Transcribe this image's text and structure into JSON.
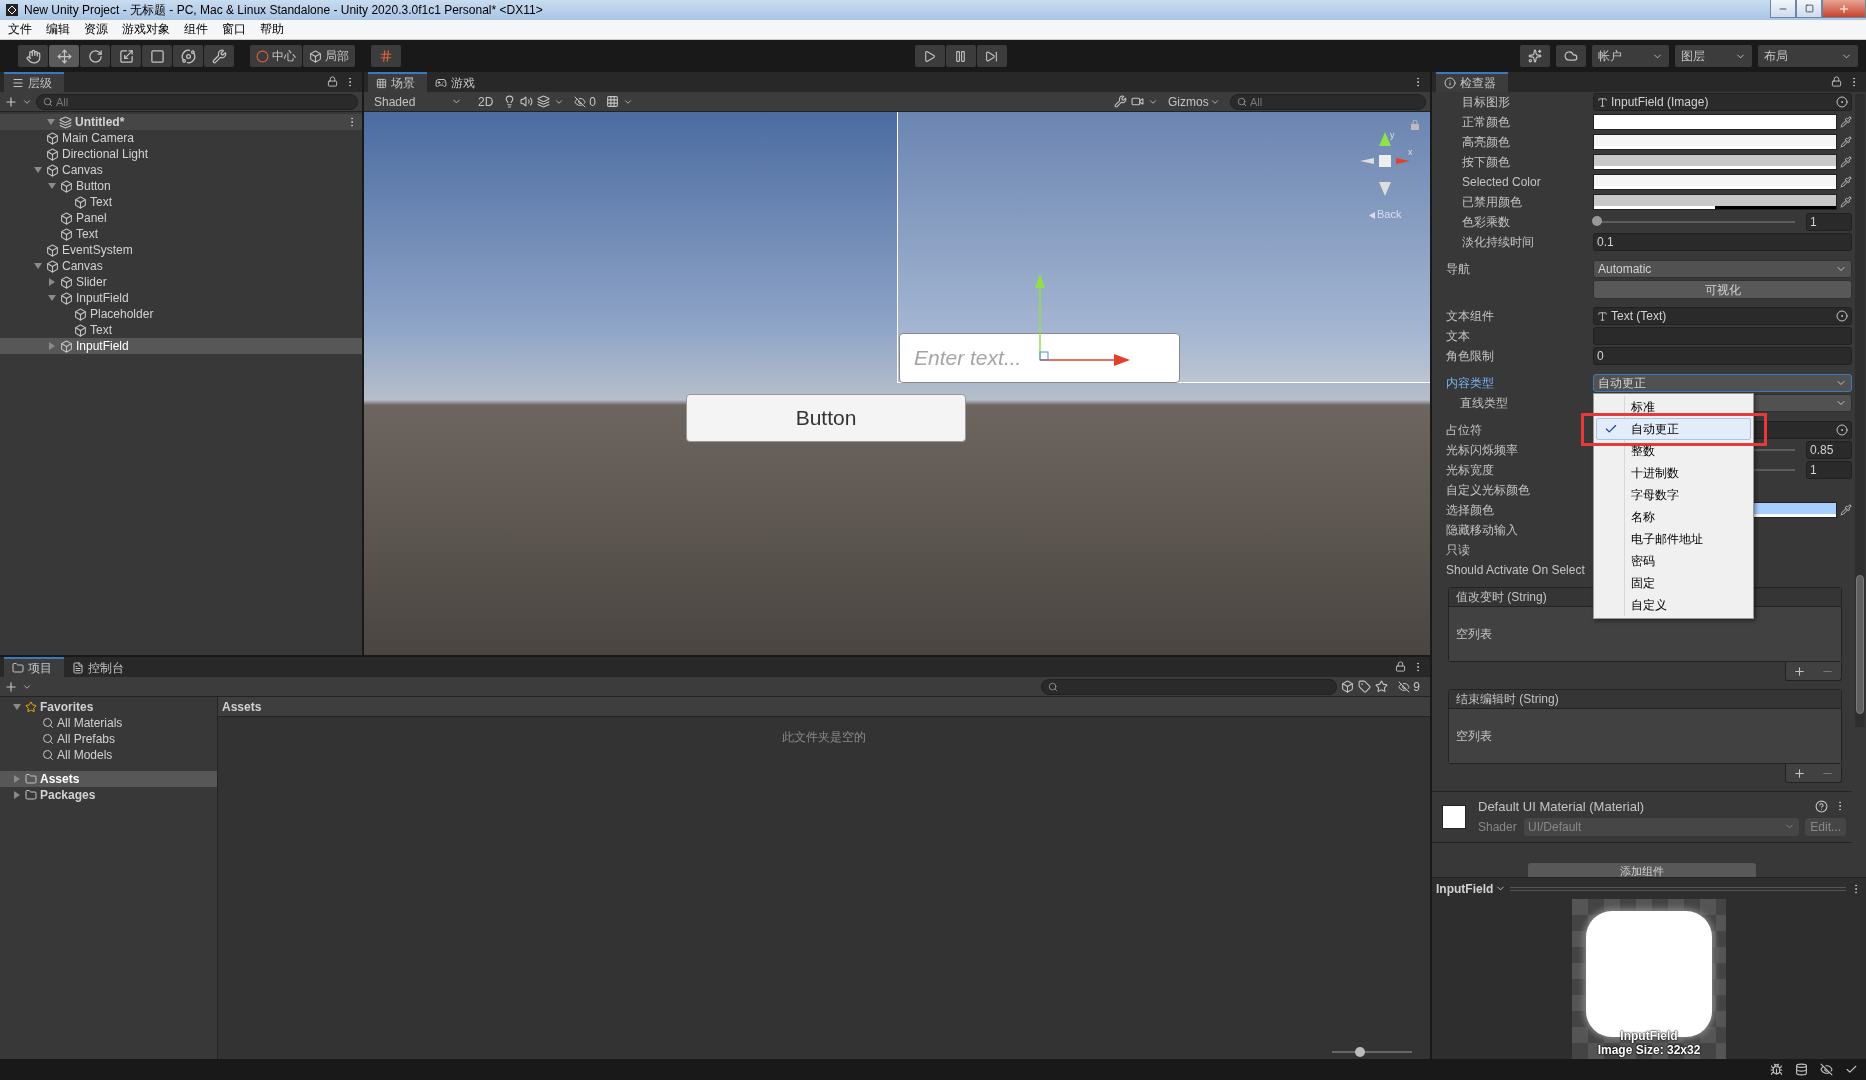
{
  "window": {
    "title": "New Unity Project - 无标题 - PC, Mac & Linux Standalone - Unity 2020.3.0f1c1 Personal* <DX11>"
  },
  "menu": [
    "文件",
    "编辑",
    "资源",
    "游戏对象",
    "组件",
    "窗口",
    "帮助"
  ],
  "toolbar": {
    "tools": [
      {
        "kind": "hand",
        "selected": false
      },
      {
        "kind": "move",
        "selected": true
      },
      {
        "kind": "rotate",
        "selected": false
      },
      {
        "kind": "scale",
        "selected": false
      },
      {
        "kind": "rect",
        "selected": false
      },
      {
        "kind": "transform",
        "selected": false
      },
      {
        "kind": "custom",
        "selected": false
      }
    ],
    "pivot": "中心",
    "space": "局部",
    "account": "帐户",
    "layers": "图层",
    "layout": "布局"
  },
  "hierarchy": {
    "tab": "层级",
    "search_placeholder": "All",
    "scene": {
      "label": "Untitled*",
      "expanded": true,
      "children": [
        {
          "label": "Main Camera",
          "selected": false
        },
        {
          "label": "Directional Light",
          "selected": false
        },
        {
          "label": "Canvas",
          "selected": false,
          "expanded": true,
          "children": [
            {
              "label": "Button",
              "selected": false,
              "expanded": true,
              "children": [
                {
                  "label": "Text",
                  "selected": false
                }
              ]
            },
            {
              "label": "Panel",
              "selected": false
            },
            {
              "label": "Text",
              "selected": false
            }
          ]
        },
        {
          "label": "EventSystem",
          "selected": false
        },
        {
          "label": "Canvas",
          "selected": false,
          "expanded": true,
          "children": [
            {
              "label": "Slider",
              "selected": false,
              "expanded": false
            },
            {
              "label": "InputField",
              "selected": false,
              "expanded": true,
              "children": [
                {
                  "label": "Placeholder",
                  "selected": false
                },
                {
                  "label": "Text",
                  "selected": false
                }
              ]
            },
            {
              "label": "InputField",
              "selected": true,
              "expanded": false
            }
          ]
        }
      ]
    }
  },
  "scene": {
    "tabs": [
      {
        "label": "场景",
        "kind": "scene",
        "selected": true
      },
      {
        "label": "游戏",
        "kind": "game",
        "selected": false
      }
    ],
    "shading": "Shaded",
    "mode_2d": "2D",
    "hidden_count": "0",
    "gizmos": "Gizmos",
    "search_placeholder": "All",
    "gizmo_axes": [
      "y",
      "x"
    ],
    "gizmo_label": "Back",
    "input_placeholder": "Enter text...",
    "button_label": "Button"
  },
  "inspector": {
    "tab": "检查器",
    "sections": [
      {
        "kind": "nested",
        "rows": [
          {
            "label": "目标图形",
            "kind": "object",
            "value": "InputField (Image)"
          },
          {
            "label": "正常颜色",
            "kind": "color",
            "color": "#ffffff",
            "level": 1
          },
          {
            "label": "高亮颜色",
            "kind": "color",
            "color": "#f5f5f5",
            "level": 1
          },
          {
            "label": "按下颜色",
            "kind": "color",
            "color": "#c8c8c8",
            "level": 1
          },
          {
            "label": "Selected Color",
            "kind": "color",
            "color": "#f5f5f5",
            "level": 1
          },
          {
            "label": "已禁用颜色",
            "kind": "color",
            "color": "#c8c8c8",
            "level": 0.5
          },
          {
            "label": "色彩乘数",
            "kind": "slider",
            "level": 0,
            "value": "1"
          },
          {
            "label": "淡化持续时间",
            "kind": "number",
            "value": "0.1"
          }
        ]
      },
      {
        "kind": "plain",
        "rows": [
          {
            "label": "导航",
            "kind": "dropdown",
            "value": "Automatic",
            "open": false
          },
          {
            "kind": "button",
            "value": "可视化"
          }
        ]
      },
      {
        "kind": "plain",
        "rows": [
          {
            "label": "文本组件",
            "kind": "object",
            "value": "Text (Text)"
          },
          {
            "label": "文本",
            "kind": "number"
          },
          {
            "label": "角色限制",
            "kind": "number",
            "value": "0"
          }
        ]
      },
      {
        "kind": "plain",
        "rows": [
          {
            "label": "内容类型",
            "kind": "dropdown",
            "value": "自动更正",
            "open": true,
            "options": [
              {
                "label": "标准",
                "selected": false
              },
              {
                "label": "自动更正",
                "selected": true
              },
              {
                "label": "整数",
                "selected": false
              },
              {
                "label": "十进制数",
                "selected": false
              },
              {
                "label": "字母数字",
                "selected": false
              },
              {
                "label": "名称",
                "selected": false
              },
              {
                "label": "电子邮件地址",
                "selected": false
              },
              {
                "label": "密码",
                "selected": false
              },
              {
                "label": "固定",
                "selected": false
              },
              {
                "label": "自定义",
                "selected": false
              }
            ],
            "children": [
              {
                "label": "直线类型",
                "kind": "dropdown",
                "open": false
              }
            ]
          }
        ]
      },
      {
        "kind": "plain",
        "rows": [
          {
            "label": "占位符",
            "kind": "object"
          },
          {
            "label": "光标闪烁频率",
            "kind": "slider",
            "value": "0.85"
          },
          {
            "label": "光标宽度",
            "kind": "slider",
            "value": "1"
          },
          {
            "label": "自定义光标颜色",
            "kind": "plain"
          },
          {
            "label": "选择颜色",
            "kind": "color",
            "color": "#a8cefe",
            "level": 1
          },
          {
            "label": "隐藏移动输入",
            "kind": "plain"
          },
          {
            "label": "只读",
            "kind": "plain"
          },
          {
            "label": "Should Activate On Select",
            "kind": "plain"
          }
        ]
      }
    ],
    "events": [
      {
        "title": "值改变时 (String)",
        "empty": "空列表"
      },
      {
        "title": "结束编辑时 (String)",
        "empty": "空列表"
      }
    ],
    "material": {
      "name": "Default UI Material (Material)",
      "shader_label": "Shader",
      "shader": "UI/Default",
      "edit": "Edit..."
    },
    "add_component": "添加组件",
    "preview": {
      "title": "InputField",
      "name": "InputField",
      "size": "Image Size: 32x32"
    }
  },
  "project": {
    "tabs": [
      {
        "label": "项目",
        "kind": "project",
        "selected": true
      },
      {
        "label": "控制台",
        "kind": "console",
        "selected": false
      }
    ],
    "hidden_count": "9",
    "tree": [
      {
        "label": "Favorites",
        "kind": "favorites",
        "expanded": true,
        "selected": false,
        "children": [
          {
            "label": "All Materials",
            "kind": "search"
          },
          {
            "label": "All Prefabs",
            "kind": "search"
          },
          {
            "label": "All Models",
            "kind": "search"
          }
        ]
      },
      {
        "label": "Assets",
        "kind": "folder",
        "expanded": false,
        "selected": true
      },
      {
        "label": "Packages",
        "kind": "folder",
        "expanded": false,
        "selected": false
      }
    ],
    "zoom": {
      "level": 0.35
    },
    "header": "Assets",
    "empty_message": "此文件夹是空的"
  }
}
